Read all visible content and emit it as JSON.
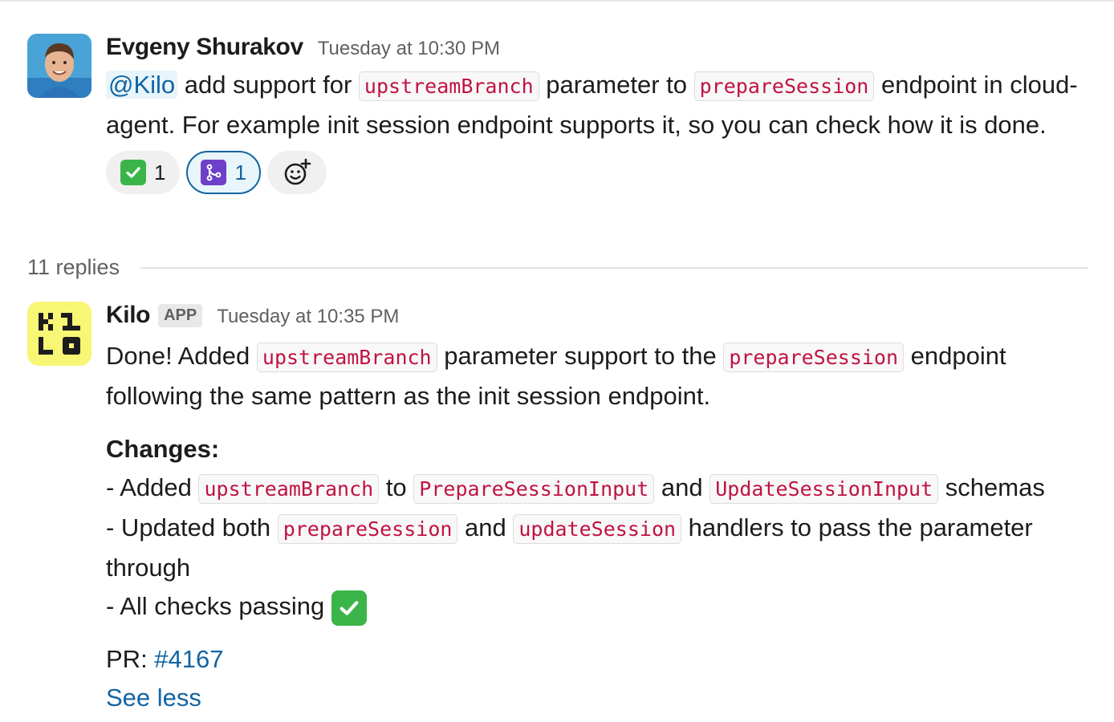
{
  "messages": [
    {
      "sender": "Evgeny Shurakov",
      "timestamp": "Tuesday at 10:30 PM",
      "mention": "@Kilo",
      "t1": " add support for ",
      "code1": "upstreamBranch",
      "t2": " parameter to ",
      "code2": "prepareSession",
      "t3": " endpoint in cloud-agent. For example init session endpoint supports it, so you can check how it is done.",
      "reactions": [
        {
          "emoji": "white-check-mark",
          "count": "1",
          "active": false
        },
        {
          "emoji": "git-merge",
          "count": "1",
          "active": true
        }
      ]
    },
    {
      "sender": "Kilo",
      "app_tag": "APP",
      "timestamp": "Tuesday at 10:35 PM",
      "p1": {
        "t1": "Done! Added ",
        "code1": "upstreamBranch",
        "t2": " parameter support to the ",
        "code2": "prepareSession",
        "t3": " endpoint following the same pattern as the init session endpoint."
      },
      "changes_heading": "Changes:",
      "line1": {
        "t1": "- Added ",
        "code1": "upstreamBranch",
        "t2": " to ",
        "code2": "PrepareSessionInput",
        "t3": " and ",
        "code3": "UpdateSessionInput",
        "t4": " schemas"
      },
      "line2": {
        "t1": "- Updated both ",
        "code1": "prepareSession",
        "t2": " and ",
        "code2": "updateSession",
        "t3": " handlers to pass the parameter through"
      },
      "line3": {
        "t1": "- All checks passing "
      },
      "pr_label": "PR: ",
      "pr_link": "#4167",
      "see_less": "See less"
    }
  ],
  "thread": {
    "replies_label": "11 replies"
  },
  "colors": {
    "code_text": "#c01343",
    "link": "#1264a3",
    "check_green": "#3bb54a",
    "merge_purple": "#6e40c9",
    "kilo_yellow": "#f8f675"
  }
}
